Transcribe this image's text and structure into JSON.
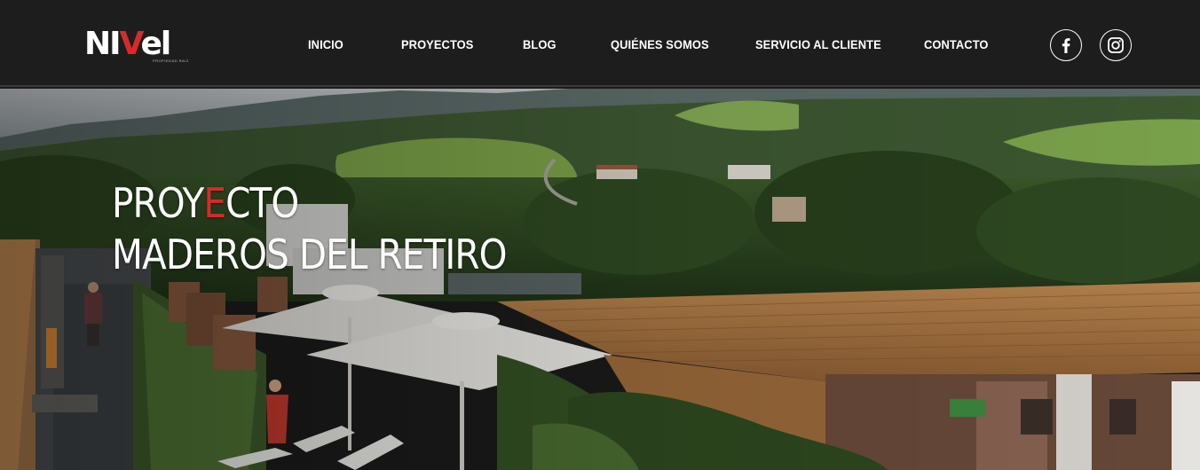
{
  "brand": {
    "logo_text_before": "NI",
    "logo_text_accent": "V",
    "logo_text_after": "el",
    "tagline": "PROPIEDAD RAIZ",
    "accent_color": "#d62b2b"
  },
  "nav": {
    "items": [
      {
        "label": "INICIO"
      },
      {
        "label": "PROYECTOS"
      },
      {
        "label": "BLOG"
      },
      {
        "label": "QUIÉNES SOMOS"
      },
      {
        "label": "SERVICIO AL CLIENTE"
      },
      {
        "label": "CONTACTO"
      }
    ]
  },
  "social": {
    "facebook_icon": "facebook-icon",
    "instagram_icon": "instagram-icon"
  },
  "hero": {
    "line1_before": "PROY",
    "line1_accent": "E",
    "line1_after": "CTO",
    "line2": "MADEROS DEL RETIRO"
  }
}
